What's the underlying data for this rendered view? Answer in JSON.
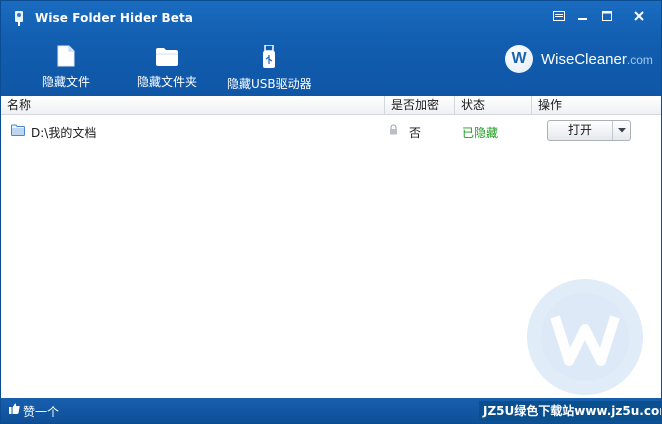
{
  "window": {
    "title": "Wise Folder Hider Beta",
    "controls": [
      "menu-icon",
      "minimize-icon",
      "maximize-icon",
      "close-icon"
    ]
  },
  "toolbar": {
    "items": [
      {
        "label": "隐藏文件",
        "icon": "file-icon"
      },
      {
        "label": "隐藏文件夹",
        "icon": "folder-icon"
      },
      {
        "label": "隐藏USB驱动器",
        "icon": "usb-drive-icon"
      }
    ]
  },
  "brand": {
    "logo_letter": "W",
    "name": "WiseCleaner",
    "suffix": ".com"
  },
  "table": {
    "columns": [
      "名称",
      "是否加密",
      "状态",
      "操作"
    ],
    "rows": [
      {
        "path": "D:\\我的文档",
        "encrypted": "否",
        "status": "已隐藏",
        "action": "打开"
      }
    ]
  },
  "statusbar": {
    "like_label": "赞一个",
    "site_tag": "JZ5U绿色下载站www.jz5u.com"
  },
  "colors": {
    "header_blue": "#125eb0",
    "status_hidden_green": "#1e9b1e",
    "statusbar_blue": "#0f4f98"
  }
}
